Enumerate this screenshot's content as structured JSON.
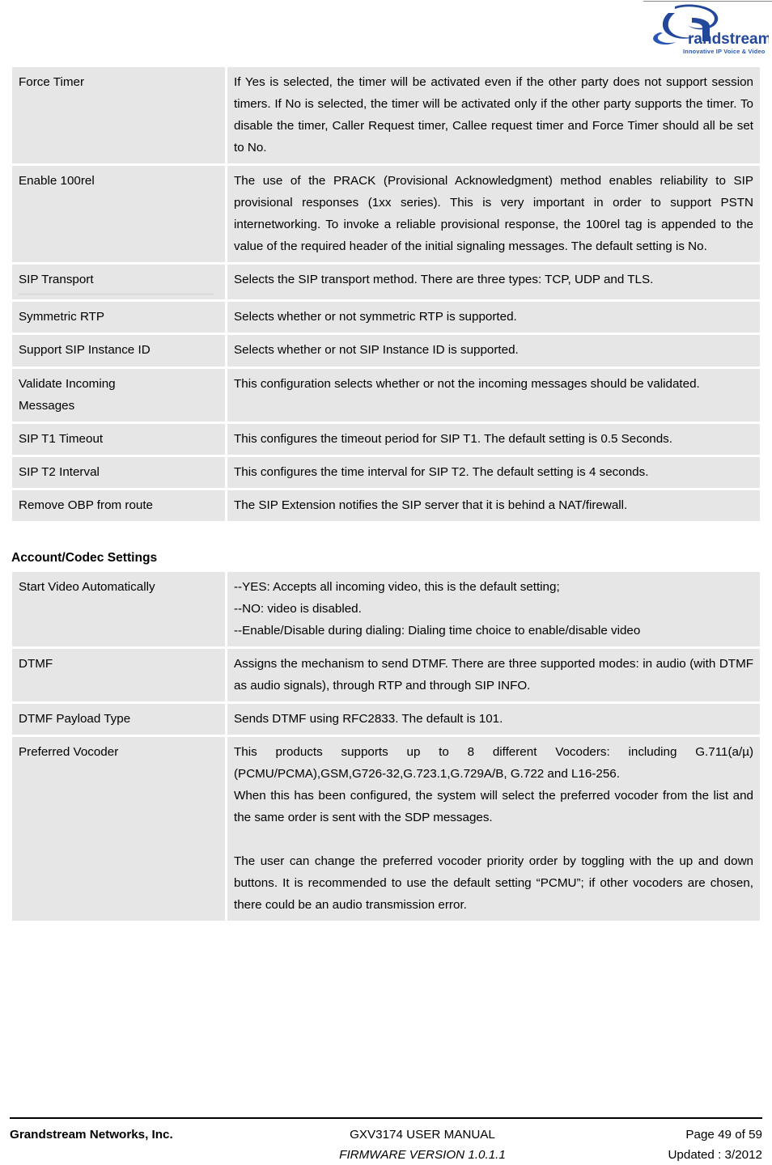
{
  "header": {
    "logo_name": "Grandstream",
    "logo_wordmark": "randstream",
    "logo_tagline": "Innovative IP Voice & Video"
  },
  "tables": [
    {
      "id": "sip-settings-table",
      "heading": null,
      "rows": [
        {
          "key": "Force Timer",
          "value": "If Yes is selected, the timer will be activated even if the other party does not support session timers. If No is selected, the timer will be activated only if the other party supports the timer. To disable the timer, Caller Request timer, Callee request timer and Force Timer should all be set to No."
        },
        {
          "key": "Enable 100rel",
          "value": "The use of the PRACK (Provisional Acknowledgment) method enables reliability to SIP provisional responses (1xx series). This is very important in order to support PSTN internetworking. To invoke a reliable provisional response, the 100rel tag is appended to the value of the required header of the initial signaling messages. The default setting is No."
        },
        {
          "key": "SIP Transport",
          "value": "Selects the SIP transport method. There are three types: TCP, UDP and TLS."
        },
        {
          "key": "Symmetric RTP",
          "value": "Selects whether or not symmetric RTP is supported."
        },
        {
          "key": "Support SIP Instance ID",
          "value": "Selects whether or not SIP Instance ID is supported."
        },
        {
          "key": "Validate          Incoming\nMessages",
          "value": "This configuration selects whether or not the incoming messages should be validated."
        },
        {
          "key": "SIP T1 Timeout",
          "value": "This configures the timeout period for SIP T1. The default setting is 0.5 Seconds."
        },
        {
          "key": "SIP T2 Interval",
          "value": "This configures the time interval for SIP T2. The default setting is 4 seconds."
        },
        {
          "key": "Remove OBP from route",
          "value": "The SIP Extension notifies the SIP server that it is behind a NAT/firewall."
        }
      ]
    },
    {
      "id": "account-codec-settings-table",
      "heading": "Account/Codec Settings",
      "rows": [
        {
          "key": "Start Video Automatically",
          "value": "--YES: Accepts all incoming video, this is the default setting;\n--NO: video is disabled.\n--Enable/Disable during dialing: Dialing time choice to enable/disable video"
        },
        {
          "key": "DTMF",
          "value": "Assigns the mechanism to send DTMF. There are three supported modes: in audio (with DTMF as audio signals), through RTP and through SIP INFO."
        },
        {
          "key": "DTMF Payload Type",
          "value": "Sends DTMF using RFC2833. The default is 101."
        },
        {
          "key": "Preferred Vocoder",
          "value": "This products supports up to 8 different Vocoders: including G.711(a/µ)(PCMU/PCMA),GSM,G726-32,G.723.1,G.729A/B,   G.722 and L16-256.\nWhen this has been configured, the system will select the preferred vocoder from the list and the same order is sent with the SDP messages.\n\nThe user can change the preferred vocoder priority order by toggling with the up and down buttons. It is recommended to use the default setting “PCMU”; if other vocoders are chosen, there could be an audio transmission error."
        }
      ]
    }
  ],
  "footer": {
    "company": "Grandstream Networks, Inc.",
    "manual_title": "GXV3174 USER MANUAL",
    "firmware": "FIRMWARE VERSION 1.0.1.1",
    "page": "Page 49 of 59",
    "updated": "Updated : 3/2012"
  },
  "colors": {
    "cell_bg": "#e6e6e6",
    "logo_blue": "#1f3f8f",
    "page_bg": "#ffffff"
  }
}
